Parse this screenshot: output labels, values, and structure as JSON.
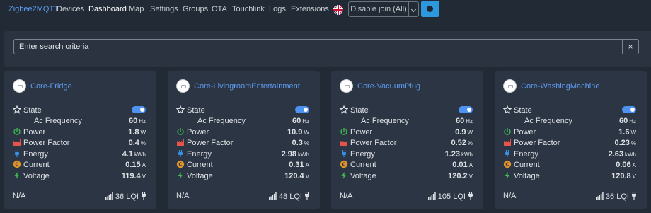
{
  "nav": {
    "brand": "Zigbee2MQTT",
    "links": [
      "Devices",
      "Dashboard",
      "Map",
      "Settings",
      "Groups",
      "OTA",
      "Touchlink",
      "Logs",
      "Extensions"
    ],
    "active": "Dashboard",
    "language_icon": "uk-flag-icon",
    "join_button": "Disable join (All)",
    "theme_icon": "moon-icon"
  },
  "search": {
    "placeholder": "Enter search criteria",
    "clear_label": "×"
  },
  "colors": {
    "accent": "#5e9bf0",
    "toggle_on": "#4e92f2",
    "theme_button": "#2e98dc"
  },
  "cards": [
    {
      "name": "Core-Fridge",
      "labels": {
        "state": "State",
        "ac_frequency": "Ac Frequency",
        "power": "Power",
        "power_factor": "Power Factor",
        "energy": "Energy",
        "current": "Current",
        "voltage": "Voltage"
      },
      "state_on": true,
      "ac_frequency": "60",
      "ac_frequency_unit": "Hz",
      "power": "1.8",
      "power_unit": "W",
      "power_factor": "0.4",
      "power_factor_unit": "%",
      "energy": "4.1",
      "energy_unit": "kWh",
      "current": "0.15",
      "current_unit": "A",
      "voltage": "119.4",
      "voltage_unit": "V",
      "last_seen": "N/A",
      "lqi": "36 LQI"
    },
    {
      "name": "Core-LivingroomEntertainment",
      "labels": {
        "state": "State",
        "ac_frequency": "Ac Frequency",
        "power": "Power",
        "power_factor": "Power Factor",
        "energy": "Energy",
        "current": "Current",
        "voltage": "Voltage"
      },
      "state_on": true,
      "ac_frequency": "60",
      "ac_frequency_unit": "Hz",
      "power": "10.9",
      "power_unit": "W",
      "power_factor": "0.3",
      "power_factor_unit": "%",
      "energy": "2.98",
      "energy_unit": "kWh",
      "current": "0.31",
      "current_unit": "A",
      "voltage": "120.4",
      "voltage_unit": "V",
      "last_seen": "N/A",
      "lqi": "48 LQI"
    },
    {
      "name": "Core-VacuumPlug",
      "labels": {
        "state": "State",
        "ac_frequency": "Ac Frequency",
        "power": "Power",
        "power_factor": "Power Factor",
        "energy": "Energy",
        "current": "Current",
        "voltage": "Voltage"
      },
      "state_on": true,
      "ac_frequency": "60",
      "ac_frequency_unit": "Hz",
      "power": "0.9",
      "power_unit": "W",
      "power_factor": "0.52",
      "power_factor_unit": "%",
      "energy": "1.23",
      "energy_unit": "kWh",
      "current": "0.01",
      "current_unit": "A",
      "voltage": "120.2",
      "voltage_unit": "V",
      "last_seen": "N/A",
      "lqi": "105 LQI"
    },
    {
      "name": "Core-WashingMachine",
      "labels": {
        "state": "State",
        "ac_frequency": "Ac Frequency",
        "power": "Power",
        "power_factor": "Power Factor",
        "energy": "Energy",
        "current": "Current",
        "voltage": "Voltage"
      },
      "state_on": true,
      "ac_frequency": "60",
      "ac_frequency_unit": "Hz",
      "power": "1.6",
      "power_unit": "W",
      "power_factor": "0.23",
      "power_factor_unit": "%",
      "energy": "2.63",
      "energy_unit": "kWh",
      "current": "0.06",
      "current_unit": "A",
      "voltage": "120.8",
      "voltage_unit": "V",
      "last_seen": "N/A",
      "lqi": "36 LQI"
    }
  ]
}
